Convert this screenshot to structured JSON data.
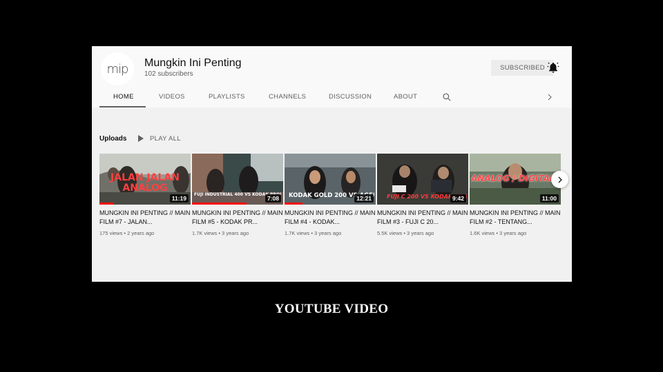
{
  "channel": {
    "avatar_text": "mip",
    "name": "Mungkin Ini Penting",
    "subscribers": "102 subscribers",
    "subscribe_label": "SUBSCRIBED",
    "bell_icon": "bell-icon"
  },
  "tabs": [
    {
      "label": "HOME",
      "active": true
    },
    {
      "label": "VIDEOS"
    },
    {
      "label": "PLAYLISTS"
    },
    {
      "label": "CHANNELS"
    },
    {
      "label": "DISCUSSION"
    },
    {
      "label": "ABOUT"
    }
  ],
  "section": {
    "title": "Uploads",
    "play_all_label": "PLAY ALL"
  },
  "videos": [
    {
      "thumb_text": "JALAN JALAN ANALOG",
      "duration": "11:19",
      "title": "MUNGKIN INI PENTING // MAIN FILM #7 - JALAN...",
      "meta": "175 views • 2 years ago",
      "watched": 0.15
    },
    {
      "thumb_text": "FUJI INDUSTRIAL 400 VS KODAK PROIMAGE 100",
      "duration": "7:08",
      "title": "MUNGKIN INI PENTING // MAIN FILM #5 - KODAK PR...",
      "meta": "1.7K views • 3 years ago",
      "watched": 0.6
    },
    {
      "thumb_text": "KODAK GOLD 200 VS AGFA VISTA",
      "duration": "12:21",
      "title": "MUNGKIN INI PENTING // MAIN FILM #4 - KODAK...",
      "meta": "1.7K views • 3 years ago",
      "watched": 0.2
    },
    {
      "thumb_text": "FUJI C 200 VS KODAK CP 2",
      "duration": "9:42",
      "title": "MUNGKIN INI PENTING // MAIN FILM #3 - FUJI C 20...",
      "meta": "5.5K views • 3 years ago",
      "watched": 0.0
    },
    {
      "thumb_text": "ANALOG / DIGITAL",
      "duration": "11:00",
      "title": "MUNGKIN INI PENTING // MAIN FILM #2 - TENTANG...",
      "meta": "1.6K views • 3 years ago",
      "watched": 0.0
    }
  ],
  "caption": "YOUTUBE VIDEO",
  "colors": {
    "accent": "#ff0000",
    "background": "#000000",
    "page": "#f9f9f9"
  }
}
